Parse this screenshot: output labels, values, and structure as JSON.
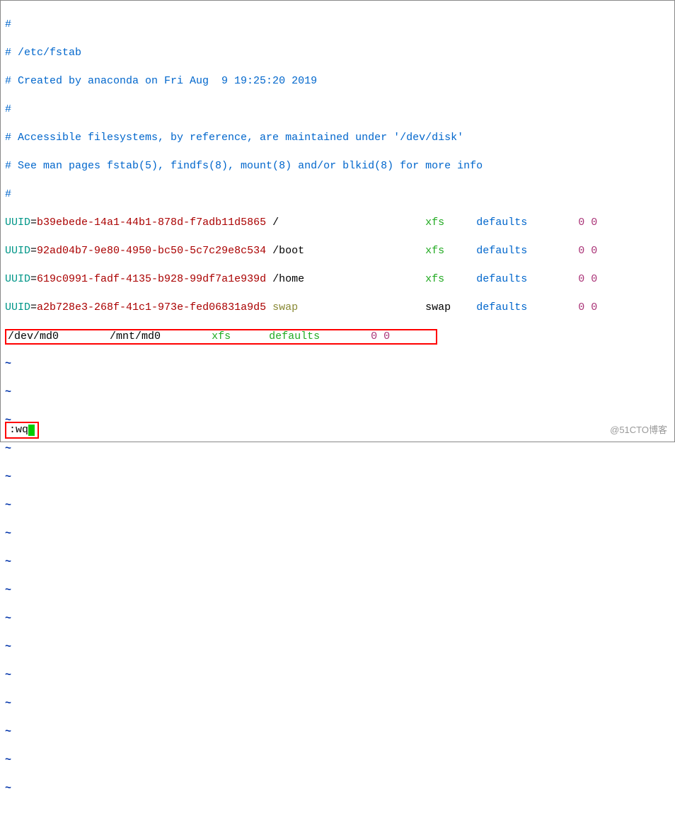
{
  "comments": {
    "l1": "#",
    "l2": "# /etc/fstab",
    "l3": "# Created by anaconda on Fri Aug  9 19:25:20 2019",
    "l4": "#",
    "l5": "# Accessible filesystems, by reference, are maintained under '/dev/disk'",
    "l6": "# See man pages fstab(5), findfs(8), mount(8) and/or blkid(8) for more info",
    "l7": "#"
  },
  "entries": {
    "uuid_label": "UUID",
    "eq": "=",
    "e1": {
      "uuid": "b39ebede-14a1-44b1-878d-f7adb11d5865",
      "mount": "/",
      "fs": "xfs",
      "opts": "defaults",
      "d1": "0",
      "d2": "0"
    },
    "e2": {
      "uuid": "92ad04b7-9e80-4950-bc50-5c7c29e8c534",
      "mount": "/boot",
      "fs": "xfs",
      "opts": "defaults",
      "d1": "0",
      "d2": "0"
    },
    "e3": {
      "uuid": "619c0991-fadf-4135-b928-99df7a1e939d",
      "mount": "/home",
      "fs": "xfs",
      "opts": "defaults",
      "d1": "0",
      "d2": "0"
    },
    "e4": {
      "uuid": "a2b728e3-268f-41c1-973e-fed06831a9d5",
      "mount": "swap",
      "fs": "swap",
      "opts": "defaults",
      "d1": "0",
      "d2": "0"
    },
    "custom": {
      "dev": "/dev/md0",
      "mount": "/mnt/md0",
      "fs": "xfs",
      "opts": "defaults",
      "d1": "0",
      "d2": "0"
    }
  },
  "tilde": "~",
  "command": ":wq",
  "watermark": "@51CTO博客"
}
